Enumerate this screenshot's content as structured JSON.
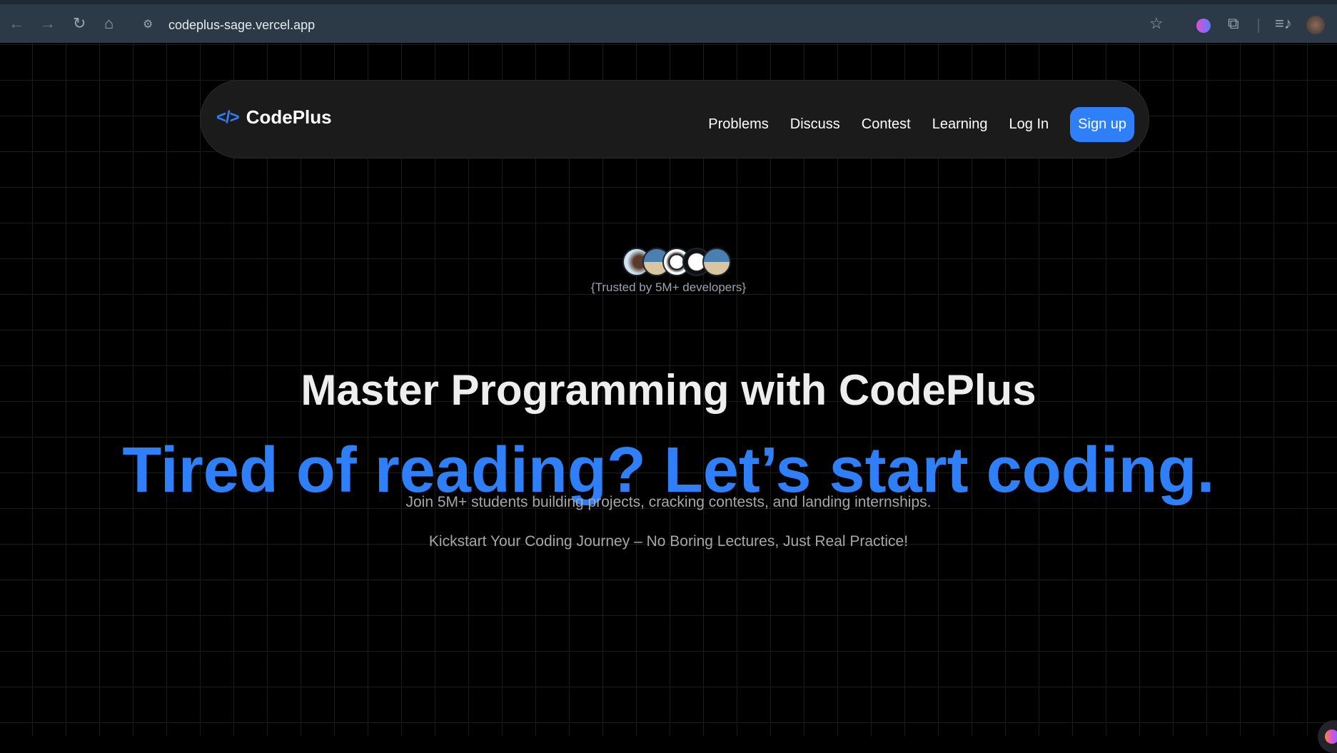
{
  "browser": {
    "url": "codeplus-sage.vercel.app"
  },
  "nav": {
    "brand": "CodePlus",
    "links": [
      "Problems",
      "Discuss",
      "Contest",
      "Learning",
      "Log In"
    ],
    "signup": "Sign up"
  },
  "hero": {
    "trusted": "{Trusted by 5M+ developers}",
    "title": "Master Programming with CodePlus",
    "headline": "Tired of reading? Let’s start coding.",
    "sub1": "Join 5M+ students building projects, cracking contests, and landing internships.",
    "sub2": "Kickstart Your Coding Journey – No Boring Lectures, Just Real Practice!"
  },
  "colors": {
    "accent": "#2f7ff8",
    "background": "#000000"
  }
}
